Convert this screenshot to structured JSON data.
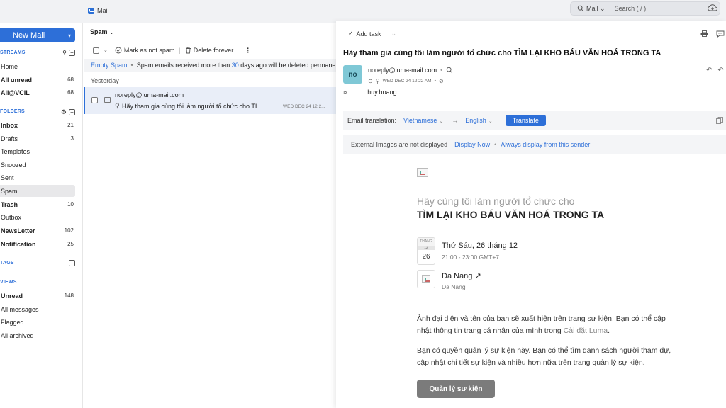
{
  "topbar": {
    "app_tab": "Mail",
    "search_scope": "Mail",
    "search_placeholder": "Search ( / )"
  },
  "sidebar": {
    "new_mail": "New Mail",
    "streams_header": "STREAMS",
    "streams": [
      {
        "label": "Home",
        "count": ""
      },
      {
        "label": "All unread",
        "count": "68"
      },
      {
        "label": "All@VCIL",
        "count": "68"
      }
    ],
    "folders_header": "FOLDERS",
    "folders": [
      {
        "label": "Inbox",
        "count": "21"
      },
      {
        "label": "Drafts",
        "count": "3"
      },
      {
        "label": "Templates",
        "count": ""
      },
      {
        "label": "Snoozed",
        "count": ""
      },
      {
        "label": "Sent",
        "count": ""
      },
      {
        "label": "Spam",
        "count": ""
      },
      {
        "label": "Trash",
        "count": "10"
      },
      {
        "label": "Outbox",
        "count": ""
      },
      {
        "label": "NewsLetter",
        "count": "102"
      },
      {
        "label": "Notification",
        "count": "25"
      }
    ],
    "tags_header": "TAGS",
    "views_header": "VIEWS",
    "views": [
      {
        "label": "Unread",
        "count": "148"
      },
      {
        "label": "All messages",
        "count": ""
      },
      {
        "label": "Flagged",
        "count": ""
      },
      {
        "label": "All archived",
        "count": ""
      }
    ]
  },
  "list": {
    "folder_title": "Spam",
    "mark_not_spam": "Mark as not spam",
    "delete_forever": "Delete forever",
    "notice": {
      "empty_spam": "Empty Spam",
      "text_before": "Spam emails received more than",
      "days": "30",
      "text_after": "days ago will be deleted permanently"
    },
    "group_label": "Yesterday",
    "message": {
      "from": "noreply@luma-mail.com",
      "subject": "Hãy tham gia cùng tôi làm người tổ chức cho TÌ...",
      "date": "WED DEC 24 12:2..."
    }
  },
  "reader": {
    "add_task": "Add task",
    "subject": "Hãy tham gia cùng tôi làm người tổ chức cho TÌM LẠI KHO BÁU VĂN HOÁ TRONG TA",
    "avatar_initials": "no",
    "sender": "noreply@luma-mail.com",
    "date": "WED DEC 24 12:22 AM",
    "recipient": "huy.hoang",
    "translation": {
      "label": "Email translation:",
      "from_lang": "Vietnamese",
      "to_lang": "English",
      "button": "Translate"
    },
    "images_notice": {
      "text": "External Images are not displayed",
      "display_now": "Display Now",
      "always_display": "Always display from this sender"
    },
    "body": {
      "headline_1": "Hãy cùng tôi làm người tổ chức cho",
      "headline_2": "TÌM LẠI KHO BÁU VĂN HOÁ TRONG TA",
      "cal_header": "THÁNG",
      "cal_month": "12",
      "cal_day": "26",
      "event_date": "Thứ Sáu, 26 tháng 12",
      "event_time": "21:00 - 23:00 GMT+7",
      "location": "Da Nang ↗",
      "location_sub": "Da Nang",
      "para1": "Ảnh đại diện và tên của bạn sẽ xuất hiện trên trang sự kiện. Bạn có thể cập nhật thông tin trang cá nhân của mình trong",
      "para1_link": "Cài đặt Luma",
      "para2": "Bạn có quyền quản lý sự kiện này. Bạn có thể tìm danh sách người tham dự, cập nhật chi tiết sự kiện và nhiều hơn nữa trên trang quản lý sự kiện.",
      "manage_button": "Quản lý sự kiện"
    }
  },
  "colors": {
    "accent": "#2d6fd8",
    "avatar_bg": "#7fc8d6",
    "selected_row": "#e9eef8"
  }
}
